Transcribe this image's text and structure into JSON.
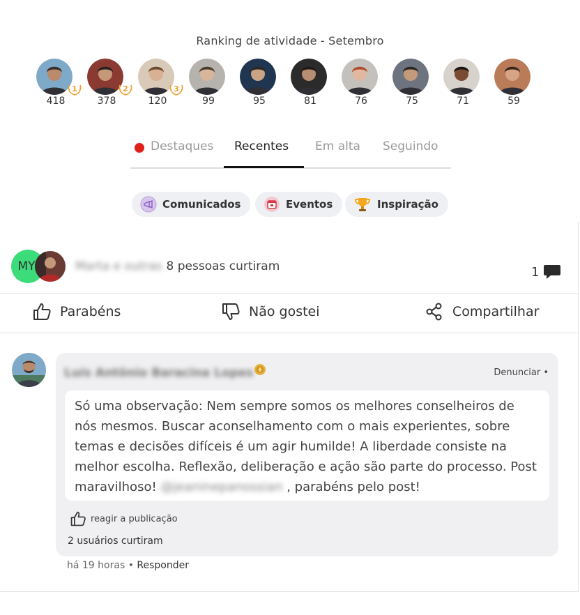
{
  "ranking": {
    "title": "Ranking de atividade - Setembro",
    "users": [
      {
        "score": "418",
        "rank": "1",
        "bg": "#7fa9c8",
        "skin": "#b98a6c",
        "hair": "#3a2e28"
      },
      {
        "score": "378",
        "rank": "2",
        "bg": "#8a3a30",
        "skin": "#c6987a",
        "hair": "#2a2020"
      },
      {
        "score": "120",
        "rank": "3",
        "bg": "#d9c9b8",
        "skin": "#d8b092",
        "hair": "#6b4a30"
      },
      {
        "score": "99",
        "rank": "",
        "bg": "#b6b2ad",
        "skin": "#d9b59a",
        "hair": "#4a3a2c"
      },
      {
        "score": "95",
        "rank": "",
        "bg": "#1f3550",
        "skin": "#c8a386",
        "hair": "#2c2620"
      },
      {
        "score": "81",
        "rank": "",
        "bg": "#2b2b2b",
        "skin": "#b88e72",
        "hair": "#1e1a18"
      },
      {
        "score": "76",
        "rank": "",
        "bg": "#c4c0bc",
        "skin": "#e0b8a0",
        "hair": "#b04a2a"
      },
      {
        "score": "75",
        "rank": "",
        "bg": "#6d7480",
        "skin": "#c49a7c",
        "hair": "#2a2622"
      },
      {
        "score": "71",
        "rank": "",
        "bg": "#d8d2cc",
        "skin": "#7a4a32",
        "hair": "#1a1412"
      },
      {
        "score": "59",
        "rank": "",
        "bg": "#b97b58",
        "skin": "#d6a484",
        "hair": "#3a2418"
      }
    ]
  },
  "tabs": [
    {
      "label": "Destaques",
      "active": false
    },
    {
      "label": "Recentes",
      "active": true
    },
    {
      "label": "Em alta",
      "active": false
    },
    {
      "label": "Seguindo",
      "active": false
    }
  ],
  "chips": [
    {
      "label": "Comunicados",
      "icon": "megaphone-icon"
    },
    {
      "label": "Eventos",
      "icon": "calendar-icon"
    },
    {
      "label": "Inspiração",
      "icon": "trophy-icon"
    }
  ],
  "post": {
    "likers_initials": "MY",
    "likers_name": "Marta e outras",
    "likers_text": "8 pessoas curtiram",
    "comment_count": "1",
    "actions": {
      "congrats": "Parabéns",
      "dislike": "Não gostei",
      "share": "Compartilhar"
    }
  },
  "comment": {
    "author": "Luís Antônio Baracina Lopes",
    "report": "Denunciar •",
    "text_before": "Só uma observação: Nem sempre somos os melhores conselheiros de nós mesmos. Buscar aconselhamento  com o mais experientes,  sobre temas e decisões difíceis é um agir humilde! A liberdade consiste na melhor escolha. Reflexão, deliberação e ação são parte do processo. Post maravilhoso! ",
    "mention": "@jeaninepanossian",
    "text_after": " , parabéns pelo post!",
    "react_label": "reagir a publicação",
    "likes_label": "2 usuários curtiram",
    "time": "há 19 horas",
    "separator": "•",
    "reply": "Responder"
  },
  "colors": {
    "live_dot": "#e0201b",
    "active_tab_underline": "#111111",
    "liker_avatar": "#3ddc7a",
    "medal": "#f0a030"
  }
}
